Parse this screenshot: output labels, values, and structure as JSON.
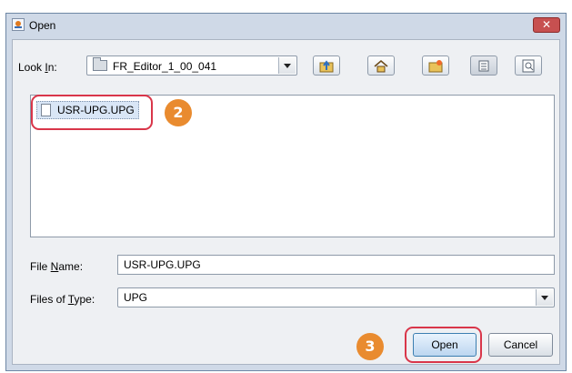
{
  "dialog": {
    "title": "Open",
    "close_symbol": "✕"
  },
  "toolbar": {
    "look_in_label_prefix": "Look ",
    "look_in_label_mnemonic": "I",
    "look_in_label_suffix": "n:",
    "look_in_value": "FR_Editor_1_00_041",
    "buttons": [
      "up-one-level",
      "home",
      "create-new-folder",
      "list-view",
      "details-view"
    ]
  },
  "file_list": {
    "items": [
      {
        "name": "USR-UPG.UPG",
        "selected": true
      }
    ]
  },
  "form": {
    "file_name_label_prefix": "File ",
    "file_name_label_mnemonic": "N",
    "file_name_label_suffix": "ame:",
    "file_name_value": "USR-UPG.UPG",
    "file_type_label_prefix": "Files of ",
    "file_type_label_mnemonic": "T",
    "file_type_label_suffix": "ype:",
    "file_type_value": "UPG"
  },
  "buttons": {
    "open_label": "Open",
    "cancel_label": "Cancel"
  },
  "callouts": {
    "step_file": "2",
    "step_open": "3"
  },
  "colors": {
    "callout_badge": "#e98b2f",
    "callout_ring": "#d9364a",
    "close_button": "#c75050"
  }
}
